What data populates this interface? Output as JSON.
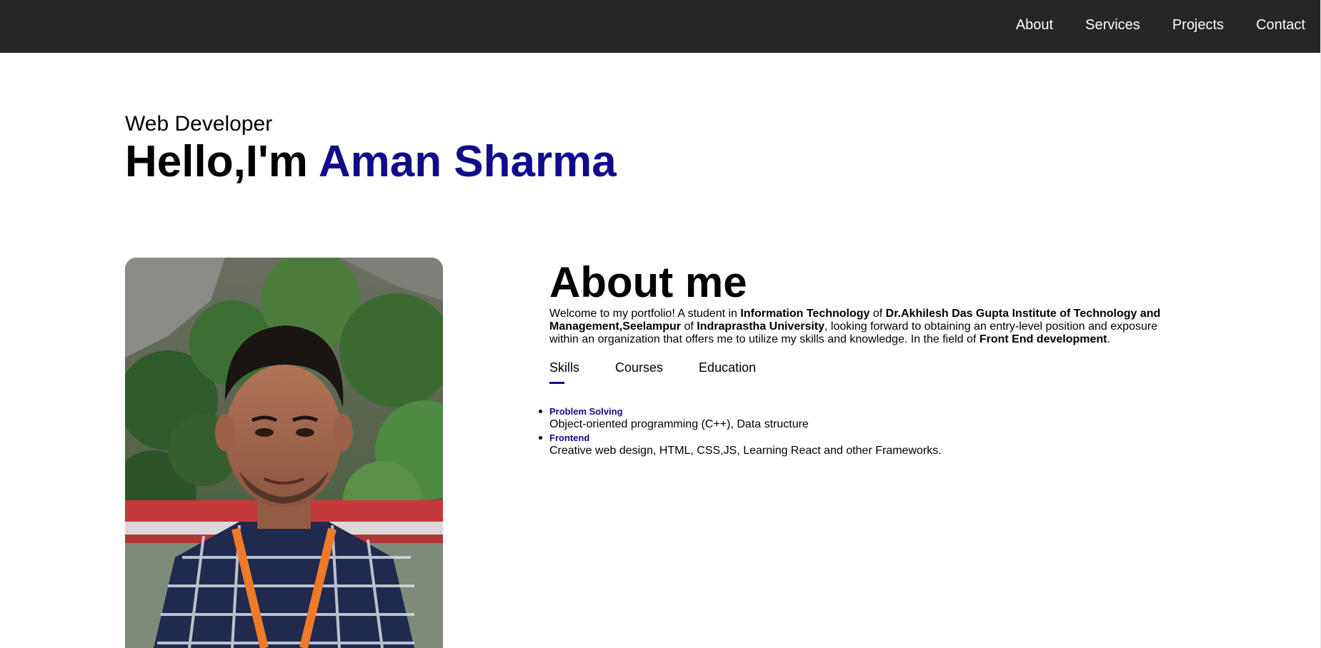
{
  "nav": {
    "links": [
      "About",
      "Services",
      "Projects",
      "Contact"
    ]
  },
  "hero": {
    "subtitle": "Web Developer",
    "greeting": "Hello,I'm ",
    "name": "Aman Sharma"
  },
  "photo": {
    "alt": "Aman Sharma"
  },
  "about": {
    "heading": "About me",
    "intro": [
      {
        "text": "Welcome to my portfolio! A student in ",
        "bold": false
      },
      {
        "text": "Information Technology",
        "bold": true
      },
      {
        "text": " of ",
        "bold": false
      },
      {
        "text": "Dr.Akhilesh Das Gupta Institute of Technology and Management,Seelampur",
        "bold": true
      },
      {
        "text": " of ",
        "bold": false
      },
      {
        "text": "Indraprastha University",
        "bold": true
      },
      {
        "text": ", looking forward to obtaining an entry-level position and exposure within an organization that offers me to utilize my skills and knowledge. In the field of ",
        "bold": false
      },
      {
        "text": "Front End development",
        "bold": true
      },
      {
        "text": ".",
        "bold": false
      }
    ],
    "tabs": [
      "Skills",
      "Courses",
      "Education"
    ],
    "active_tab": "Skills",
    "skills": [
      {
        "name": "Problem Solving",
        "desc": "Object-oriented programming (C++), Data structure"
      },
      {
        "name": "Frontend",
        "desc": "Creative web design, HTML, CSS,JS, Learning React and other Frameworks."
      }
    ]
  },
  "colors": {
    "nav_bg": "#262626",
    "accent": "#130a8a"
  }
}
